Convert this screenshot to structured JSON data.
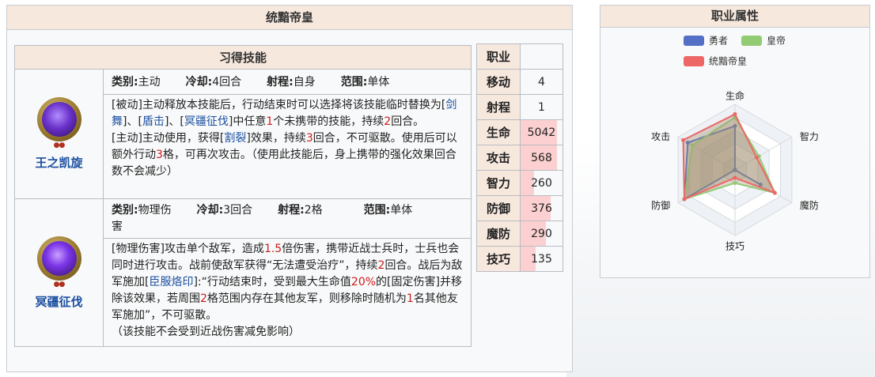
{
  "page": {
    "title": "统黯帝皇"
  },
  "skills_section": {
    "header": "习得技能",
    "skills": [
      {
        "name": "王之凯旋",
        "icon": "dark-king-icon",
        "meta": {
          "type_label": "类别:",
          "type": "主动",
          "cd_label": "冷却:",
          "cd": "4回合",
          "range_label": "射程:",
          "range": "自身",
          "area_label": "范围:",
          "area": "单体"
        },
        "desc": {
          "p1_a": "[被动]主动释放本技能后，行动结束时可以选择将该技能临时替换为[",
          "link1": "剑舞",
          "p1_b": "]、[",
          "link2": "盾击",
          "p1_c": "]、[",
          "link3": "冥疆征伐",
          "p1_d": "]中任意",
          "num1": "1",
          "p1_e": "个未携带的技能，持续",
          "num2": "2",
          "p1_f": "回合。",
          "p2_a": "[主动]主动使用，获得[",
          "link4": "割裂",
          "p2_b": "]效果，持续",
          "num3": "3",
          "p2_c": "回合，不可驱散。使用后可以额外行动",
          "num4": "3",
          "p2_d": "格，可再次攻击。（使用此技能后，身上携带的强化效果回合数不会减少）"
        }
      },
      {
        "name": "冥疆征伐",
        "icon": "purple-claw-icon",
        "meta": {
          "type_label": "类别:",
          "type": "物理伤",
          "cd_label": "冷却:",
          "cd": "3回合",
          "range_label": "射程:",
          "range": "2格",
          "area_label": "范围:",
          "area": "单体",
          "wrap": "害"
        },
        "desc": {
          "a": "[物理伤害]攻击单个敌军，造成",
          "num1": "1.5",
          "b": "倍伤害，携带近战士兵时，士兵也会同时进行攻击。战前使敌军获得“无法遭受治疗”，持续",
          "num2": "2",
          "c": "回合。战后为敌军施加[",
          "link1": "臣服烙印",
          "d": "]:“行动结束时，受到最大生命值",
          "num3": "20%",
          "e": "的[固定伤害]并移除该效果，若周围",
          "num4": "2",
          "f": "格范围内存在其他友军，则移除时随机为",
          "num5": "1",
          "g": "名其他友军施加”，不可驱散。",
          "h": "（该技能不会受到近战伤害减免影响）"
        }
      }
    ]
  },
  "stats": {
    "class_label": "职业",
    "class_value": "",
    "rows": [
      {
        "label": "移动",
        "value": "4",
        "bar": 0
      },
      {
        "label": "射程",
        "value": "1",
        "bar": 0
      },
      {
        "label": "生命",
        "value": "5042",
        "bar": 0.86
      },
      {
        "label": "攻击",
        "value": "568",
        "bar": 0.86
      },
      {
        "label": "智力",
        "value": "260",
        "bar": 0.33
      },
      {
        "label": "防御",
        "value": "376",
        "bar": 0.72
      },
      {
        "label": "魔防",
        "value": "290",
        "bar": 0.6
      },
      {
        "label": "技巧",
        "value": "135",
        "bar": 0.35
      }
    ]
  },
  "radar": {
    "title": "职业属性",
    "legend": [
      "勇者",
      "皇帝",
      "统黯帝皇"
    ],
    "axes": [
      "生命",
      "智力",
      "魔防",
      "技巧",
      "防御",
      "攻击"
    ],
    "series": [
      {
        "name": "勇者",
        "color": "#5470c6",
        "values": [
          0.67,
          0.0,
          0.45,
          0.0,
          0.89,
          0.83
        ]
      },
      {
        "name": "皇帝",
        "color": "#91cc75",
        "values": [
          0.8,
          0.42,
          0.7,
          0.2,
          0.89,
          0.75
        ]
      },
      {
        "name": "统黯帝皇",
        "color": "#ee6666",
        "values": [
          0.85,
          0.38,
          0.7,
          0.12,
          0.89,
          0.91
        ]
      }
    ]
  }
}
